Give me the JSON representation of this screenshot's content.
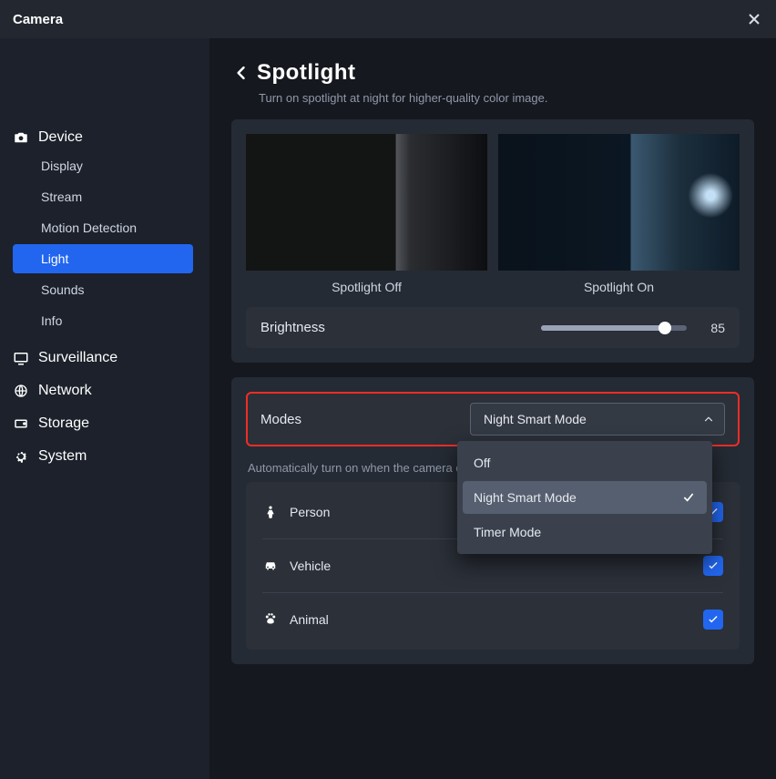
{
  "window": {
    "title": "Camera"
  },
  "sidebar": {
    "device": {
      "label": "Device",
      "items": [
        "Display",
        "Stream",
        "Motion Detection",
        "Light",
        "Sounds",
        "Info"
      ],
      "activeIndex": 3
    },
    "surveillance": {
      "label": "Surveillance"
    },
    "network": {
      "label": "Network"
    },
    "storage": {
      "label": "Storage"
    },
    "system": {
      "label": "System"
    }
  },
  "page": {
    "title": "Spotlight",
    "subtitle": "Turn on spotlight at night for higher-quality color image."
  },
  "previews": {
    "off": "Spotlight Off",
    "on": "Spotlight On"
  },
  "brightness": {
    "label": "Brightness",
    "value": "85"
  },
  "modes": {
    "label": "Modes",
    "selected": "Night Smart Mode",
    "description": "Automatically turn on when the camera detects",
    "options": {
      "opt0": "Off",
      "opt1": "Night Smart Mode",
      "opt2": "Timer Mode"
    }
  },
  "detections": {
    "person": {
      "label": "Person",
      "checked": true
    },
    "vehicle": {
      "label": "Vehicle",
      "checked": true
    },
    "animal": {
      "label": "Animal",
      "checked": true
    }
  }
}
